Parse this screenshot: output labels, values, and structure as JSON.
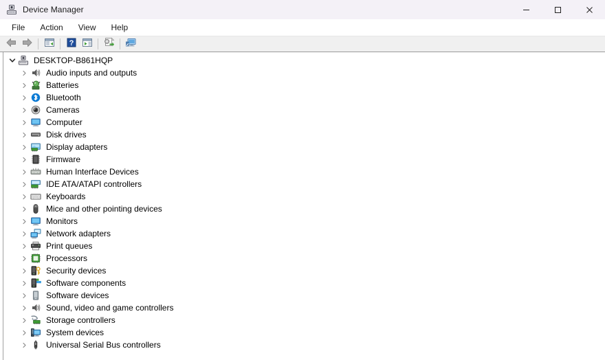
{
  "window": {
    "title": "Device Manager",
    "icon": "device-manager-icon",
    "controls": {
      "minimize": "minimize-button",
      "maximize": "maximize-button",
      "close": "close-button"
    }
  },
  "menubar": {
    "items": [
      {
        "label": "File",
        "name": "menu-file"
      },
      {
        "label": "Action",
        "name": "menu-action"
      },
      {
        "label": "View",
        "name": "menu-view"
      },
      {
        "label": "Help",
        "name": "menu-help"
      }
    ]
  },
  "toolbar": {
    "buttons": [
      {
        "name": "back-button",
        "icon": "back-arrow-icon"
      },
      {
        "name": "forward-button",
        "icon": "forward-arrow-icon"
      },
      {
        "name": "toolbar-separator-1",
        "icon": "separator"
      },
      {
        "name": "properties-button",
        "icon": "properties-icon"
      },
      {
        "name": "toolbar-separator-2",
        "icon": "separator"
      },
      {
        "name": "help-button",
        "icon": "help-question-icon"
      },
      {
        "name": "update-driver-button",
        "icon": "update-driver-icon"
      },
      {
        "name": "toolbar-separator-3",
        "icon": "separator"
      },
      {
        "name": "scan-hardware-changes-button",
        "icon": "scan-hardware-icon"
      },
      {
        "name": "toolbar-separator-4",
        "icon": "separator"
      },
      {
        "name": "show-hidden-devices-button",
        "icon": "monitor-scan-icon"
      }
    ]
  },
  "tree": {
    "root": {
      "label": "DESKTOP-B861HQP",
      "expanded": true,
      "icon": "computer-root-icon"
    },
    "items": [
      {
        "label": "Audio inputs and outputs",
        "icon": "speaker-icon",
        "expanded": false
      },
      {
        "label": "Batteries",
        "icon": "battery-icon",
        "expanded": false
      },
      {
        "label": "Bluetooth",
        "icon": "bluetooth-icon",
        "expanded": false
      },
      {
        "label": "Cameras",
        "icon": "camera-icon",
        "expanded": false
      },
      {
        "label": "Computer",
        "icon": "computer-icon",
        "expanded": false
      },
      {
        "label": "Disk drives",
        "icon": "disk-drive-icon",
        "expanded": false
      },
      {
        "label": "Display adapters",
        "icon": "display-adapter-icon",
        "expanded": false
      },
      {
        "label": "Firmware",
        "icon": "firmware-chip-icon",
        "expanded": false
      },
      {
        "label": "Human Interface Devices",
        "icon": "hid-icon",
        "expanded": false
      },
      {
        "label": "IDE ATA/ATAPI controllers",
        "icon": "ide-controller-icon",
        "expanded": false
      },
      {
        "label": "Keyboards",
        "icon": "keyboard-icon",
        "expanded": false
      },
      {
        "label": "Mice and other pointing devices",
        "icon": "mouse-icon",
        "expanded": false
      },
      {
        "label": "Monitors",
        "icon": "monitor-icon",
        "expanded": false
      },
      {
        "label": "Network adapters",
        "icon": "network-adapter-icon",
        "expanded": false
      },
      {
        "label": "Print queues",
        "icon": "printer-icon",
        "expanded": false
      },
      {
        "label": "Processors",
        "icon": "processor-icon",
        "expanded": false
      },
      {
        "label": "Security devices",
        "icon": "security-key-icon",
        "expanded": false
      },
      {
        "label": "Software components",
        "icon": "software-component-icon",
        "expanded": false
      },
      {
        "label": "Software devices",
        "icon": "software-device-icon",
        "expanded": false
      },
      {
        "label": "Sound, video and game controllers",
        "icon": "sound-controller-icon",
        "expanded": false
      },
      {
        "label": "Storage controllers",
        "icon": "storage-controller-icon",
        "expanded": false
      },
      {
        "label": "System devices",
        "icon": "system-device-icon",
        "expanded": false
      },
      {
        "label": "Universal Serial Bus controllers",
        "icon": "usb-icon",
        "expanded": false
      }
    ]
  },
  "colors": {
    "titlebar_bg": "#f4f1f7",
    "toolbar_bg": "#f0f0f0",
    "content_bg": "#ffffff",
    "text": "#000000",
    "bluetooth_blue": "#0a7ad4",
    "accent_green": "#3f9c35",
    "border": "#a0a0a0"
  }
}
